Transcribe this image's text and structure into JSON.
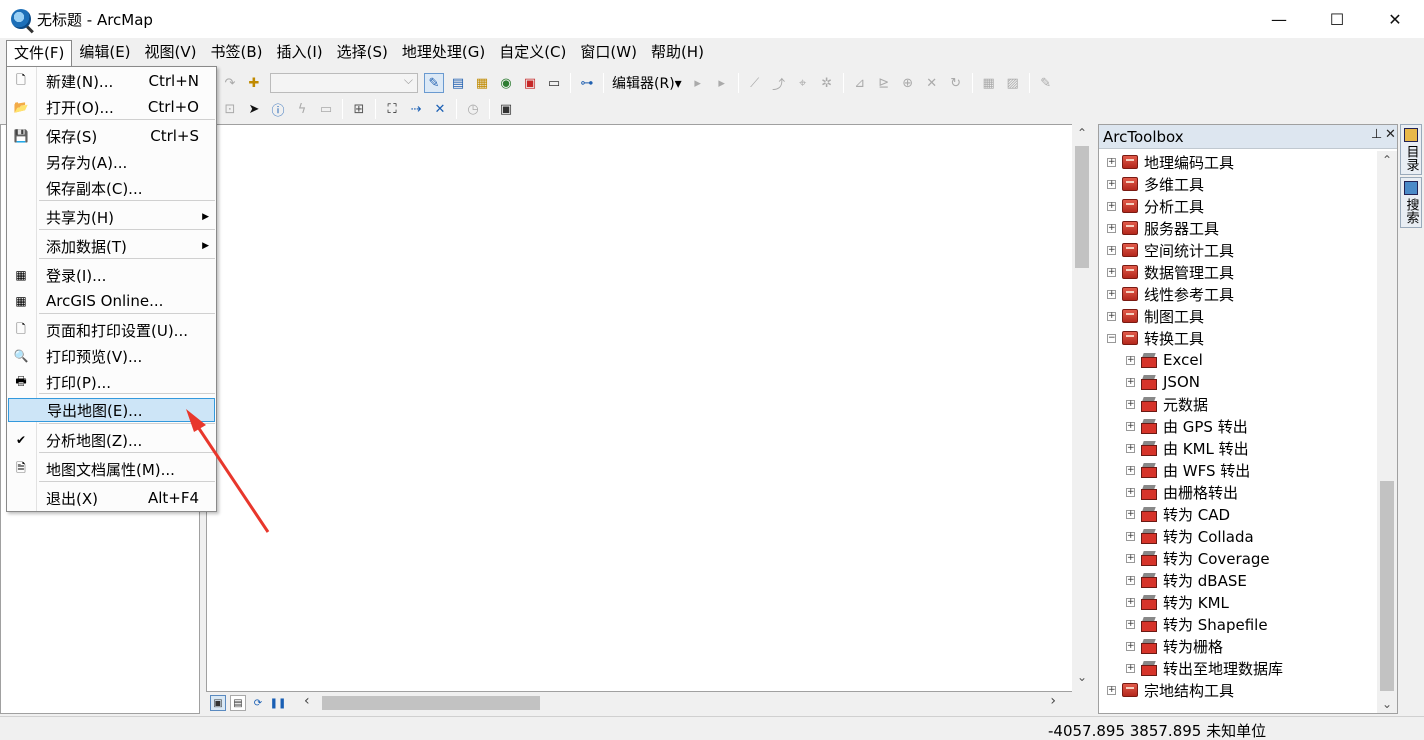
{
  "window": {
    "title": "无标题 - ArcMap",
    "minimize": "—",
    "maximize": "☐",
    "close": "✕"
  },
  "menubar": [
    "文件(F)",
    "编辑(E)",
    "视图(V)",
    "书签(B)",
    "插入(I)",
    "选择(S)",
    "地理处理(G)",
    "自定义(C)",
    "窗口(W)",
    "帮助(H)"
  ],
  "toolbar": {
    "editor_label": "编辑器(R)▾"
  },
  "file_menu": [
    {
      "label": "新建(N)...",
      "shortcut": "Ctrl+N",
      "icon": "new-document-icon"
    },
    {
      "label": "打开(O)...",
      "shortcut": "Ctrl+O",
      "icon": "open-folder-icon"
    },
    {
      "label": "保存(S)",
      "shortcut": "Ctrl+S",
      "icon": "save-disk-icon"
    },
    {
      "label": "另存为(A)...",
      "shortcut": "",
      "icon": ""
    },
    {
      "label": "保存副本(C)...",
      "shortcut": "",
      "icon": ""
    },
    {
      "label": "共享为(H)",
      "shortcut": "",
      "icon": "",
      "submenu": true
    },
    {
      "label": "添加数据(T)",
      "shortcut": "",
      "icon": "",
      "submenu": true
    },
    {
      "label": "登录(I)...",
      "shortcut": "",
      "icon": "sign-in-grid-icon"
    },
    {
      "label": "ArcGIS Online...",
      "shortcut": "",
      "icon": "arcgis-online-grid-icon"
    },
    {
      "label": "页面和打印设置(U)...",
      "shortcut": "",
      "icon": "page-setup-icon"
    },
    {
      "label": "打印预览(V)...",
      "shortcut": "",
      "icon": "print-preview-icon"
    },
    {
      "label": "打印(P)...",
      "shortcut": "",
      "icon": "printer-icon"
    },
    {
      "label": "导出地图(E)...",
      "shortcut": "",
      "icon": "",
      "highlighted": true
    },
    {
      "label": "分析地图(Z)...",
      "shortcut": "",
      "icon": "analyze-map-icon"
    },
    {
      "label": "地图文档属性(M)...",
      "shortcut": "",
      "icon": "document-properties-icon"
    },
    {
      "label": "退出(X)",
      "shortcut": "Alt+F4",
      "icon": ""
    }
  ],
  "arctoolbox": {
    "title": "ArcToolbox",
    "pin": "⊥",
    "close": "✕",
    "items": [
      {
        "label": "地理编码工具",
        "level": 0,
        "expanded": false
      },
      {
        "label": "多维工具",
        "level": 0,
        "expanded": false
      },
      {
        "label": "分析工具",
        "level": 0,
        "expanded": false
      },
      {
        "label": "服务器工具",
        "level": 0,
        "expanded": false
      },
      {
        "label": "空间统计工具",
        "level": 0,
        "expanded": false
      },
      {
        "label": "数据管理工具",
        "level": 0,
        "expanded": false
      },
      {
        "label": "线性参考工具",
        "level": 0,
        "expanded": false
      },
      {
        "label": "制图工具",
        "level": 0,
        "expanded": false
      },
      {
        "label": "转换工具",
        "level": 0,
        "expanded": true
      },
      {
        "label": "Excel",
        "level": 1,
        "expanded": false
      },
      {
        "label": "JSON",
        "level": 1,
        "expanded": false
      },
      {
        "label": "元数据",
        "level": 1,
        "expanded": false
      },
      {
        "label": "由 GPS 转出",
        "level": 1,
        "expanded": false
      },
      {
        "label": "由 KML 转出",
        "level": 1,
        "expanded": false
      },
      {
        "label": "由 WFS 转出",
        "level": 1,
        "expanded": false
      },
      {
        "label": "由栅格转出",
        "level": 1,
        "expanded": false
      },
      {
        "label": "转为 CAD",
        "level": 1,
        "expanded": false
      },
      {
        "label": "转为 Collada",
        "level": 1,
        "expanded": false
      },
      {
        "label": "转为 Coverage",
        "level": 1,
        "expanded": false
      },
      {
        "label": "转为 dBASE",
        "level": 1,
        "expanded": false
      },
      {
        "label": "转为 KML",
        "level": 1,
        "expanded": false
      },
      {
        "label": "转为 Shapefile",
        "level": 1,
        "expanded": false
      },
      {
        "label": "转为栅格",
        "level": 1,
        "expanded": false
      },
      {
        "label": "转出至地理数据库",
        "level": 1,
        "expanded": false
      },
      {
        "label": "宗地结构工具",
        "level": 0,
        "expanded": false
      }
    ]
  },
  "side_tabs": [
    "目录",
    "搜索"
  ],
  "status": {
    "coords": "-4057.895  3857.895 未知单位"
  },
  "colors": {
    "highlight": "#cde5f7",
    "highlight_border": "#3399dd",
    "annotation_arrow": "#e8372c"
  }
}
